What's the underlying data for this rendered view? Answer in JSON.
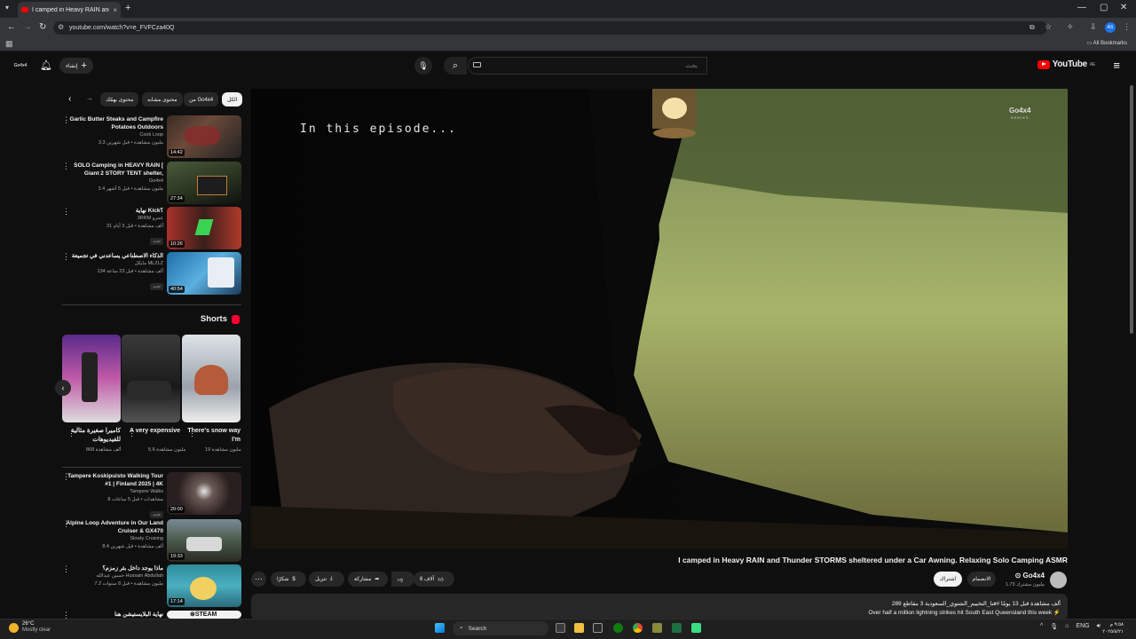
{
  "browser": {
    "tab_title": "I camped in Heavy RAIN and Thunder STORMS sheltered under a Car Awning. Relaxing Solo Camping ASMR",
    "url": "youtube.com/watch?v=e_FVFCza40Q",
    "all_bookmarks": "All Bookmarks",
    "profile": "AS"
  },
  "header": {
    "logo": "YouTube",
    "region": "AE",
    "search_placeholder": "بحث",
    "create_label": "إنشاء",
    "avatar_text": "Go4x4"
  },
  "chips": [
    "الكل",
    "من Go4x4",
    "محتوى مشابه",
    "محتوى يهمّك"
  ],
  "sidebar": {
    "videos": [
      {
        "title": "Garlic Butter Steaks and Campfire Potatoes Outdoors",
        "channel": "Cook Loop",
        "views": "3.3 مليون مشاهدة • قبل شهرين",
        "duration": "14:42"
      },
      {
        "title": "SOLO Camping in HEAVY RAIN [ Giant 2 STORY TENT shelter,",
        "channel": "Go4x4",
        "views": "3.4 مليون مشاهدة • قبل 5 أشهر",
        "duration": "27:34"
      },
      {
        "title": "نهاية Kick؟",
        "channel": "3RRM عمرو",
        "views": "31 ألف مشاهدة • قبل 3 أيام",
        "duration": "10:26",
        "badge": "جديد"
      },
      {
        "title": "الذكاء الاصطناعي يساعدني في تجميعة",
        "channel": "مايكل MLZLZ",
        "views": "134 ألف مشاهدة • قبل 23 ساعة",
        "duration": "40:54",
        "badge": "جديد"
      }
    ],
    "shorts_heading": "Shorts",
    "shorts": [
      {
        "title": "There's snow way I'm",
        "views": "19 مليون مشاهدة"
      },
      {
        "title": "A very expensive",
        "views": "5.6 مليون مشاهدة"
      },
      {
        "title": "كاميرا صغيرة مثالية للفيديوهات",
        "views": "868 ألف مشاهدة"
      }
    ],
    "videos2": [
      {
        "title": "Tampere Koskipuisto Walking Tour #1 | Finland 2025 | 4K",
        "channel": "Tampere Walks",
        "views": "8 مشاهدات • قبل 5 ساعات",
        "duration": "20:00",
        "badge": "جديد"
      },
      {
        "title": "Alpine Loop Adventure in Our Land Cruiser & GX470",
        "channel": "Slowly Cruising",
        "views": "8.4 ألف مشاهدة • قبل شهرين",
        "duration": "19:33"
      },
      {
        "title": "ماذا يوجد داخل بئر زمزم؟",
        "channel": "حسين عبدالله Hussain Abdullah",
        "views": "7.2 مليون مشاهدة • قبل 8 سنوات",
        "duration": "17:14"
      },
      {
        "title": "نهاية البلايستيشن هنا",
        "channel": "",
        "views": "",
        "duration": ""
      }
    ]
  },
  "player": {
    "overlay_text": "In this episode...",
    "watermark": "Go4x4",
    "watermark_sub": "SERIES"
  },
  "video": {
    "title": "I camped in Heavy RAIN and Thunder STORMS sheltered under a Car Awning. Relaxing Solo Camping ASMR",
    "channel": "Go4x4",
    "subscribers": "1.73 مليون مشترك",
    "join": "الانضمام",
    "subscribe": "اشتراك",
    "likes": "6 آلاف",
    "share": "مشاركة",
    "download": "تنزيل",
    "thanks": "شكرًا",
    "meta": "289 ألف مشاهدة قبل 13 يومًا  #قنا_التخييم_الشتوي_السعودية 3 مقاطع",
    "description": "Over half a million lightning strikes hit South East Queensland this week ⚡"
  },
  "taskbar": {
    "temp": "26°C",
    "weather": "Mostly clear",
    "search": "Search",
    "time": "٩:٥٨ م",
    "date": "٢٠٢٥/٨/٢١",
    "lang": "ENG"
  }
}
